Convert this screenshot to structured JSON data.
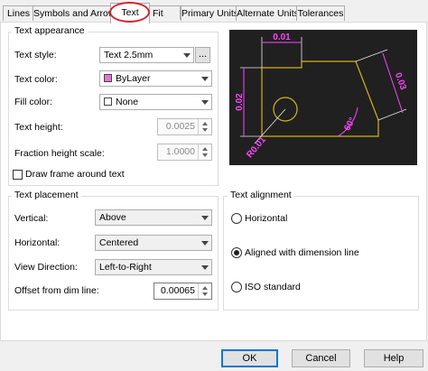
{
  "tabs": [
    {
      "label": "Lines",
      "active": false
    },
    {
      "label": "Symbols and Arrows",
      "active": false
    },
    {
      "label": "Text",
      "active": true
    },
    {
      "label": "Fit",
      "active": false
    },
    {
      "label": "Primary Units",
      "active": false
    },
    {
      "label": "Alternate Units",
      "active": false
    },
    {
      "label": "Tolerances",
      "active": false
    }
  ],
  "text_appearance": {
    "legend": "Text appearance",
    "text_style_label": "Text style:",
    "text_style_value": "Text 2.5mm",
    "browse_label": "...",
    "text_color_label": "Text color:",
    "text_color_value": "ByLayer",
    "text_color_swatch": "#e872d8",
    "fill_color_label": "Fill color:",
    "fill_color_value": "None",
    "text_height_label": "Text height:",
    "text_height_value": "0.0025",
    "fraction_label": "Fraction height scale:",
    "fraction_value": "1.0000",
    "frame_label": "Draw frame around text",
    "frame_checked": false
  },
  "preview": {
    "dim_top": "0.01",
    "dim_left": "0.02",
    "dim_right": "0.03",
    "dim_angle": "60°",
    "dim_radius": "R0.01",
    "line_color": "#e8e8e8",
    "dim_color": "#ff44ff",
    "shape_color": "#d6b01e"
  },
  "text_placement": {
    "legend": "Text placement",
    "vertical_label": "Vertical:",
    "vertical_value": "Above",
    "horizontal_label": "Horizontal:",
    "horizontal_value": "Centered",
    "view_dir_label": "View Direction:",
    "view_dir_value": "Left-to-Right",
    "offset_label": "Offset from dim line:",
    "offset_value": "0.00065"
  },
  "text_alignment": {
    "legend": "Text alignment",
    "options": [
      {
        "label": "Horizontal",
        "selected": false
      },
      {
        "label": "Aligned with dimension line",
        "selected": true
      },
      {
        "label": "ISO standard",
        "selected": false
      }
    ]
  },
  "buttons": {
    "ok": "OK",
    "cancel": "Cancel",
    "help": "Help"
  }
}
